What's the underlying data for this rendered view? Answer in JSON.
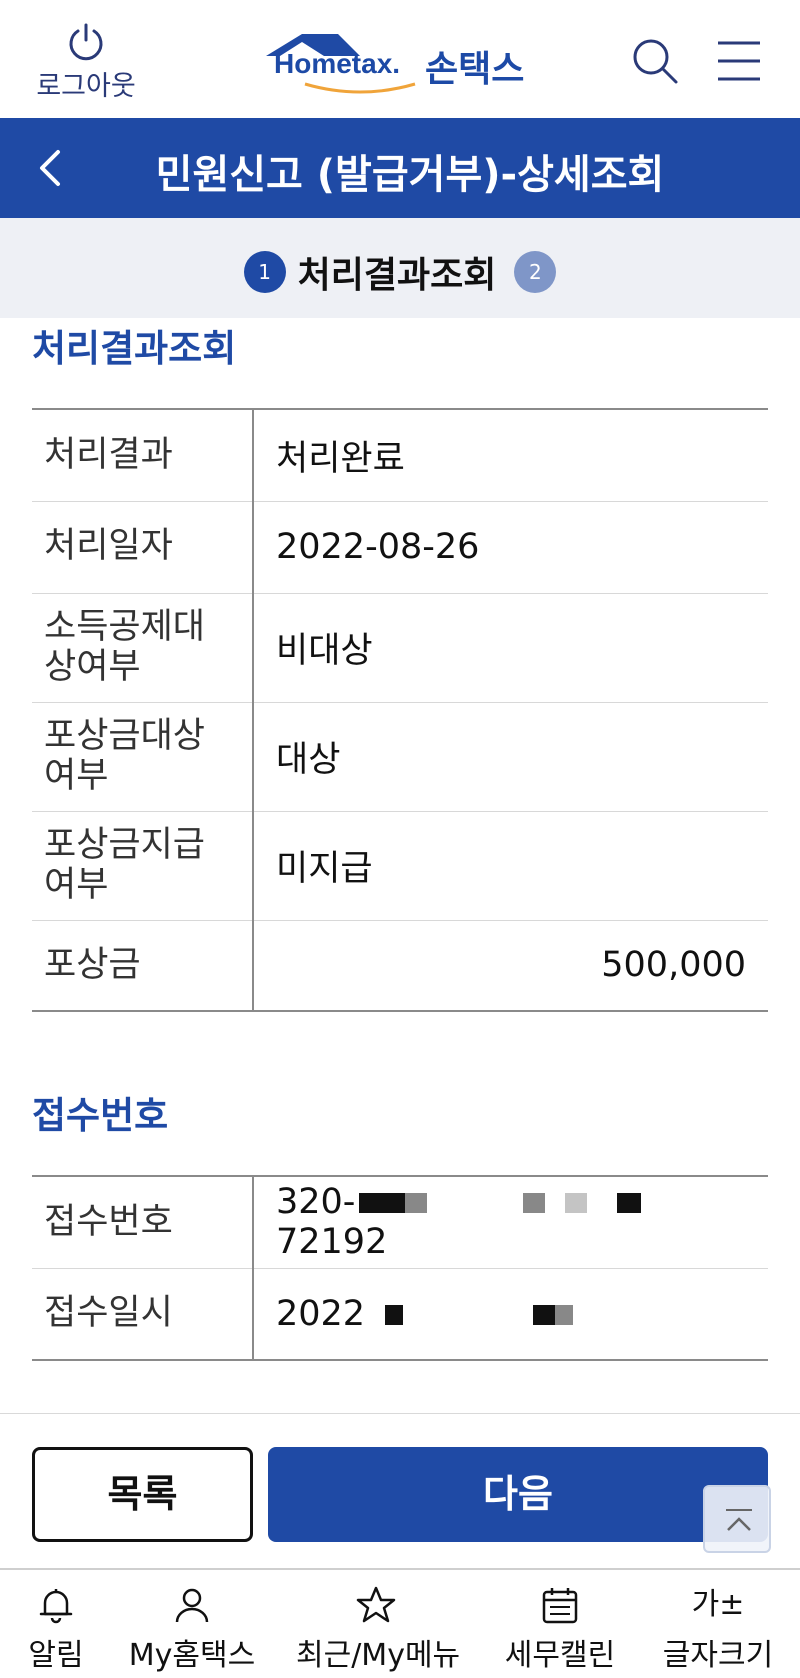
{
  "header": {
    "logout_label": "로그아웃",
    "logo_en": "Hometax.",
    "logo_ko": "손택스"
  },
  "titlebar": {
    "title": "민원신고 (발급거부)-상세조회"
  },
  "steps": {
    "step1_number": "1",
    "step1_label": "처리결과조회",
    "step2_number": "2"
  },
  "result_section": {
    "heading": "처리결과조회",
    "rows": [
      {
        "label": "처리결과",
        "value": "처리완료"
      },
      {
        "label": "처리일자",
        "value": "2022-08-26"
      },
      {
        "label_line1": "소득공제대",
        "label_line2": "상여부",
        "value": "비대상"
      },
      {
        "label_line1": "포상금대상",
        "label_line2": "여부",
        "value": "대상"
      },
      {
        "label_line1": "포상금지급",
        "label_line2": "여부",
        "value": "미지급"
      },
      {
        "label": "포상금",
        "value": "500,000"
      }
    ]
  },
  "receipt_section": {
    "heading": "접수번호",
    "rows": [
      {
        "label": "접수번호",
        "value_start": "320-",
        "value_end": "72192"
      },
      {
        "label": "접수일시",
        "value_start": "2022"
      }
    ]
  },
  "buttons": {
    "list_label": "목록",
    "next_label": "다음"
  },
  "bottom_nav": {
    "items": [
      {
        "label": "알림",
        "icon": "bell-icon"
      },
      {
        "label": "My홈택스",
        "icon": "person-icon"
      },
      {
        "label": "최근/My메뉴",
        "icon": "star-icon"
      },
      {
        "label": "세무캘린",
        "icon": "calendar-icon"
      },
      {
        "label": "글자크기",
        "icon": "font-size-icon",
        "icon_text": "가±"
      }
    ]
  },
  "colors": {
    "brand_blue": "#1f4aa5",
    "status_orange": "#e2712d"
  }
}
